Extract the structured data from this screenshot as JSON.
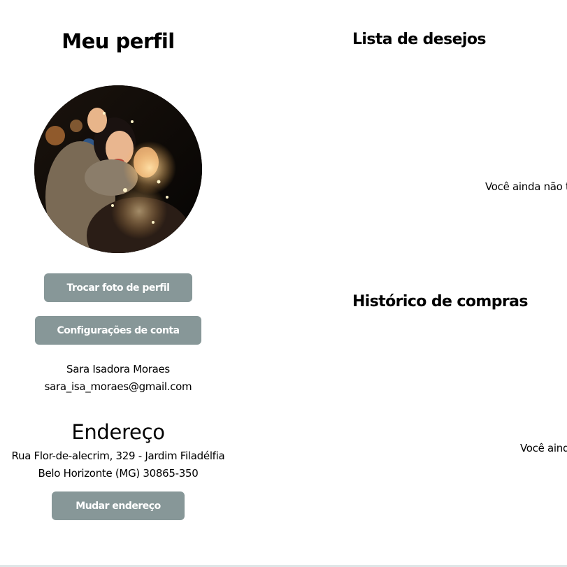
{
  "profile": {
    "title": "Meu perfil",
    "change_photo_label": "Trocar foto de perfil",
    "account_settings_label": "Configurações de conta",
    "user_name": "Sara Isadora Moraes",
    "user_email": "sara_isa_moraes@gmail.com"
  },
  "address": {
    "title": "Endereço",
    "line1": "Rua Flor-de-alecrim, 329 - Jardim Filadélfia",
    "line2": "Belo Horizonte (MG) 30865-350",
    "change_label": "Mudar endereço"
  },
  "wishlist": {
    "title": "Lista de desejos",
    "empty_text": "Você ainda não t"
  },
  "history": {
    "title": "Histórico de compras",
    "empty_text": "Você aind"
  },
  "colors": {
    "button_bg": "#879798",
    "button_text": "#ffffff",
    "text": "#000000",
    "background": "#ffffff"
  }
}
